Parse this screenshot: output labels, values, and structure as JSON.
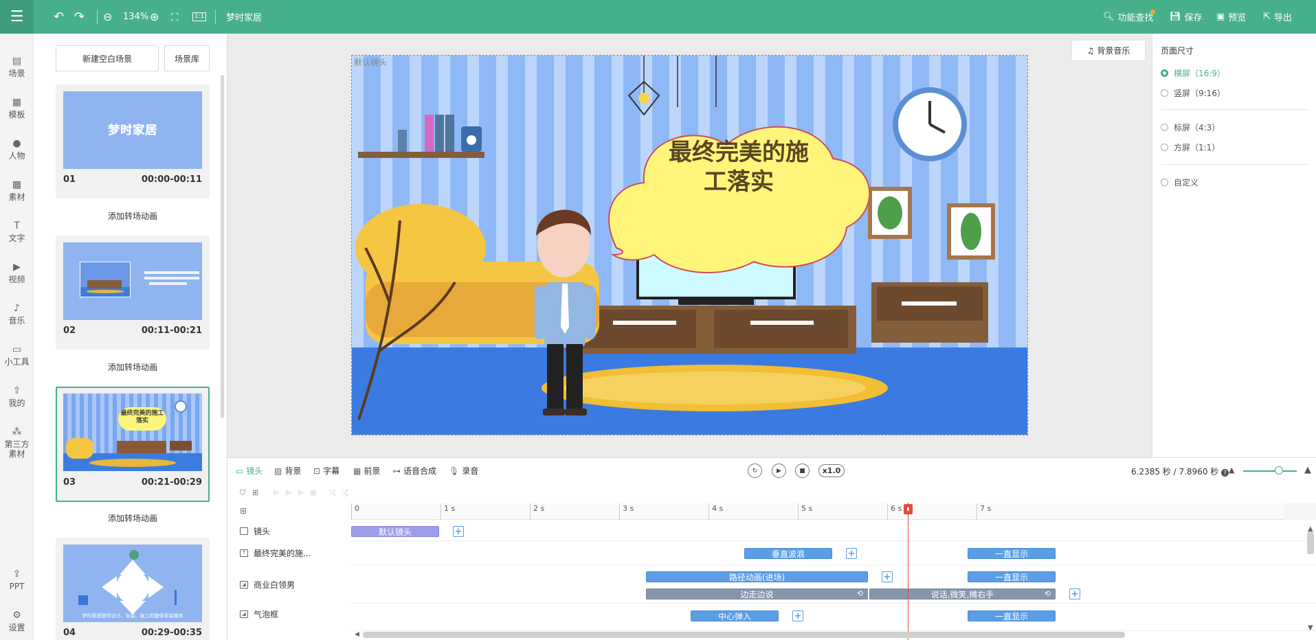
{
  "topbar": {
    "zoom": "134%",
    "project_name": "梦时家居",
    "feature_search": "功能查找",
    "save": "保存",
    "preview": "预览",
    "export": "导出",
    "accent_color": "#46b08a"
  },
  "sidebar": {
    "items": [
      {
        "label": "场景",
        "icon": "scene-icon"
      },
      {
        "label": "模板",
        "icon": "template-icon"
      },
      {
        "label": "人物",
        "icon": "person-icon"
      },
      {
        "label": "素材",
        "icon": "asset-icon"
      },
      {
        "label": "文字",
        "icon": "text-icon"
      },
      {
        "label": "视频",
        "icon": "video-icon"
      },
      {
        "label": "音乐",
        "icon": "music-icon"
      },
      {
        "label": "小工具",
        "icon": "toolbox-icon"
      },
      {
        "label": "我的",
        "icon": "upload-icon"
      },
      {
        "label": "第三方",
        "label2": "素材",
        "icon": "third-party-icon"
      }
    ],
    "bottom": [
      {
        "label": "PPT",
        "icon": "ppt-icon"
      },
      {
        "label": "设置",
        "icon": "settings-icon"
      }
    ]
  },
  "scenes": {
    "new_blank": "新建空白场景",
    "library": "场景库",
    "add_transition": "添加转场动画",
    "list": [
      {
        "num": "01",
        "time": "00:00-00:11",
        "thumb_title": "梦时家居"
      },
      {
        "num": "02",
        "time": "00:11-00:21"
      },
      {
        "num": "03",
        "time": "00:21-00:29",
        "thumb_title": "最终完美的施工落实"
      },
      {
        "num": "04",
        "time": "00:29-00:35",
        "thumb_caption": "梦时家居提供设计、安装、施工的整体家装服务"
      }
    ]
  },
  "canvas": {
    "default_camera_label": "默认镜头",
    "speech_text_line1": "最终完美的施",
    "speech_text_line2": "工落实",
    "bgm_button": "背景音乐"
  },
  "page_size": {
    "title": "页面尺寸",
    "options": [
      "横屏（16:9）",
      "竖屏（9:16）",
      "标屏（4:3）",
      "方屏（1:1）",
      "自定义"
    ],
    "selected_index": 0
  },
  "timeline": {
    "tabs": [
      "镜头",
      "背景",
      "字幕",
      "前景",
      "语音合成",
      "录音"
    ],
    "active_tab": 0,
    "speed": "x1.0",
    "timecode": "6.2385 秒 / 7.8960 秒",
    "ruler": [
      "0",
      "1 s",
      "2 s",
      "3 s",
      "4 s",
      "5 s",
      "6 s",
      "7 s"
    ],
    "playhead_seconds": 6.2385,
    "total_seconds": 7.896,
    "tracks": [
      {
        "name": "镜头",
        "clips": [
          {
            "label": "默认镜头",
            "color": "purple",
            "start": 0,
            "end": 1.0
          }
        ]
      },
      {
        "name": "最终完美的施...",
        "clips": [
          {
            "label": "垂直波浪",
            "color": "blue",
            "start": 4.4,
            "end": 5.4
          },
          {
            "label": "一直显示",
            "color": "blue",
            "start": 6.9,
            "end": 7.9
          }
        ]
      },
      {
        "name": "商业白领男",
        "clips": [
          {
            "label": "路径动画(进场)",
            "color": "blue",
            "start": 3.3,
            "end": 5.8
          },
          {
            "label": "一直显示",
            "color": "blue",
            "start": 6.9,
            "end": 7.9
          },
          {
            "label": "边走边说",
            "color": "grey",
            "start": 3.3,
            "end": 5.8
          },
          {
            "label": "说话,微笑,摊右手",
            "color": "grey",
            "start": 5.8,
            "end": 7.9
          }
        ]
      },
      {
        "name": "气泡框",
        "clips": [
          {
            "label": "中心弹入",
            "color": "blue",
            "start": 3.8,
            "end": 4.8
          },
          {
            "label": "一直显示",
            "color": "blue",
            "start": 6.9,
            "end": 7.9
          }
        ]
      }
    ]
  }
}
